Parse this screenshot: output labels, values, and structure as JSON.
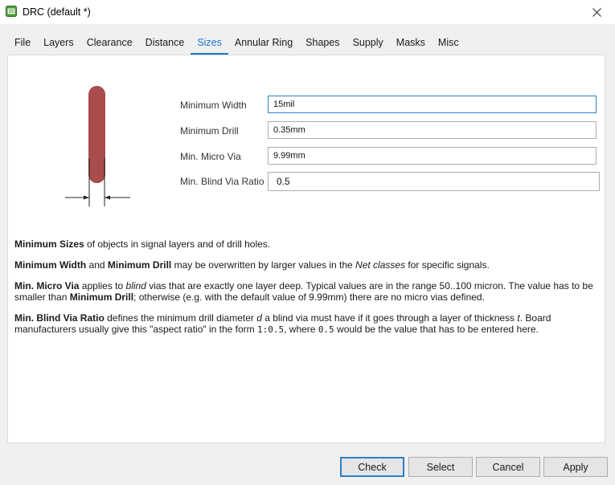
{
  "window": {
    "title": "DRC (default *)",
    "close_icon": "close-icon"
  },
  "tabs": [
    {
      "label": "File"
    },
    {
      "label": "Layers"
    },
    {
      "label": "Clearance"
    },
    {
      "label": "Distance"
    },
    {
      "label": "Sizes",
      "active": true
    },
    {
      "label": "Annular Ring"
    },
    {
      "label": "Shapes"
    },
    {
      "label": "Supply"
    },
    {
      "label": "Masks"
    },
    {
      "label": "Misc"
    }
  ],
  "sizes": {
    "min_width_label": "Minimum Width",
    "min_width_value": "15mil",
    "min_drill_label": "Minimum Drill",
    "min_drill_value": "0.35mm",
    "min_micro_via_label": "Min. Micro Via",
    "min_micro_via_value": "9.99mm",
    "min_blind_via_ratio_label": "Min. Blind Via Ratio",
    "min_blind_via_ratio_value": "0.5"
  },
  "description": {
    "p1_bold": "Minimum Sizes",
    "p1_rest": " of objects in signal layers and of drill holes.",
    "p2_bold1": "Minimum Width",
    "p2_and": " and ",
    "p2_bold2": "Minimum Drill",
    "p2_mid": " may be overwritten by larger values in the ",
    "p2_italic": "Net classes",
    "p2_end": " for specific signals.",
    "p3_bold1": "Min. Micro Via",
    "p3_a": " applies to ",
    "p3_italic": "blind",
    "p3_b": " vias that are exactly one layer deep. Typical values are in the range 50..100 micron. The value has to be smaller than ",
    "p3_bold2": "Minimum Drill",
    "p3_c": "; otherwise (e.g. with the default value of 9.99mm) there are no micro vias defined.",
    "p4_bold": "Min. Blind Via Ratio",
    "p4_a": " defines the minimum drill diameter ",
    "p4_italic1": "d",
    "p4_b": " a blind via must have if it goes through a layer of thickness ",
    "p4_italic2": "t",
    "p4_c": ". Board manufacturers usually give this \"aspect ratio\" in the form ",
    "p4_code1": "1:0.5",
    "p4_d": ", where ",
    "p4_code2": "0.5",
    "p4_e": " would be the value that has to be entered here."
  },
  "buttons": {
    "check": "Check",
    "select": "Select",
    "cancel": "Cancel",
    "apply": "Apply"
  },
  "colors": {
    "accent": "#1a77c9",
    "trace": "#a84c4c"
  }
}
